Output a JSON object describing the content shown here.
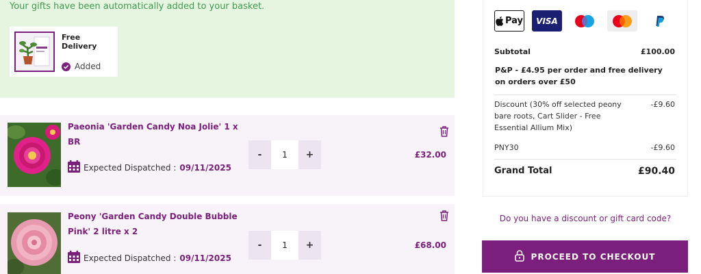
{
  "gift": {
    "message": "Your gifts have been automatically added to your basket.",
    "item_name": "Free Delivery",
    "status": "Added"
  },
  "cart": {
    "items": [
      {
        "title": "Paeonia 'Garden Candy Noa Jolie' 1 x BR",
        "dispatch_label": "Expected Dispatched :",
        "dispatch_date": "09/11/2025",
        "qty_minus": "-",
        "quantity": "1",
        "qty_plus": "+",
        "price": "£32.00"
      },
      {
        "title": "Peony 'Garden Candy Double Bubble Pink' 2 litre x 2",
        "dispatch_label": "Expected Dispatched :",
        "dispatch_date": "09/11/2025",
        "qty_minus": "-",
        "quantity": "1",
        "qty_plus": "+",
        "price": "£68.00"
      }
    ]
  },
  "summary": {
    "payment_icons": [
      "apple-pay-icon",
      "visa-icon",
      "maestro-icon",
      "mastercard-icon",
      "paypal-icon"
    ],
    "apple_pay_label": "Pay",
    "visa_label": "VISA",
    "subtotal_label": "Subtotal",
    "subtotal_value": "£100.00",
    "pp_text": "P&P - £4.95 per order and free delivery on orders over £50",
    "discount_label": "Discount (30% off selected peony bare roots, Cart Slider - Free Essential Allium Mix)",
    "discount_value": "-£9.60",
    "code_label": "PNY30",
    "code_value": "-£9.60",
    "grand_total_label": "Grand Total",
    "grand_total_value": "£90.40",
    "discount_link": "Do you have a discount or gift card code?",
    "checkout_label": "PROCEED TO CHECKOUT"
  },
  "colors": {
    "brand": "#7b1f7c",
    "gift_bg": "#e6f5e0",
    "gift_text": "#3f9a52",
    "item_bg": "#f8f3f9"
  }
}
